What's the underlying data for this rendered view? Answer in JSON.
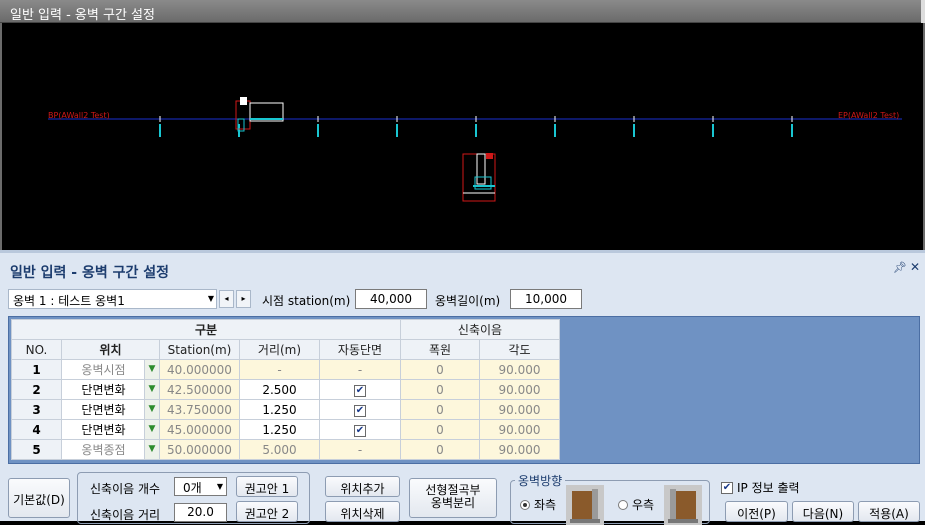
{
  "viewport": {
    "title": "일반 입력 - 옹벽 구간 설정",
    "label_left": "BP(AWall2 Test)",
    "label_right": "EP(AWall2 Test)"
  },
  "panel": {
    "title": "일반 입력 - 옹벽 구간 설정",
    "pin_icon": "pin-icon",
    "close_icon": "close-icon"
  },
  "toolbar": {
    "wall_select": "옹벽 1 : 테스트 옹벽1",
    "prev": "◂",
    "next": "▸",
    "start_station_label": "시점 station(m)",
    "start_station_value": "40,000",
    "wall_length_label": "옹벽길이(m)",
    "wall_length_value": "10,000"
  },
  "grid": {
    "group_header": "구분",
    "group_header2": "신축이음",
    "columns": [
      "NO.",
      "위치",
      "Station(m)",
      "거리(m)",
      "자동단면",
      "폭원",
      "각도"
    ],
    "rows": [
      {
        "no": "1",
        "pos": "옹벽시점",
        "station": "40.000000",
        "dist": "-",
        "auto": "-",
        "width": "0",
        "angle": "90.000"
      },
      {
        "no": "2",
        "pos": "단면변화",
        "station": "42.500000",
        "dist": "2.500",
        "auto": "✔",
        "width": "0",
        "angle": "90.000"
      },
      {
        "no": "3",
        "pos": "단면변화",
        "station": "43.750000",
        "dist": "1.250",
        "auto": "✔",
        "width": "0",
        "angle": "90.000"
      },
      {
        "no": "4",
        "pos": "단면변화",
        "station": "45.000000",
        "dist": "1.250",
        "auto": "✔",
        "width": "0",
        "angle": "90.000"
      },
      {
        "no": "5",
        "pos": "옹벽종점",
        "station": "50.000000",
        "dist": "5.000",
        "auto": "-",
        "width": "0",
        "angle": "90.000"
      }
    ]
  },
  "bottom": {
    "default_btn": "기본값(D)",
    "joint_count_label": "신축이음 개수",
    "joint_count_value": "0개",
    "joint_dist_label": "신축이음 거리",
    "joint_dist_value": "20.0",
    "recommend1": "권고안 1",
    "recommend2": "권고안 2",
    "add_pos": "위치추가",
    "del_pos": "위치삭제",
    "split_btn_line1": "선형절곡부",
    "split_btn_line2": "옹벽분리",
    "direction_legend": "옹벽방향",
    "left_label": "좌측",
    "right_label": "우측",
    "ip_label": "IP 정보 출력",
    "prev_btn": "이전(P)",
    "next_btn": "다음(N)",
    "apply_btn": "적용(A)"
  },
  "colors": {
    "panel_bg": "#dde6f2",
    "title_color": "#1c3c6e",
    "grid_bg": "#6f92c3",
    "alignment_line": "#1a2fd0",
    "station_tick": "#19c6d1",
    "label_red": "#d01818"
  }
}
